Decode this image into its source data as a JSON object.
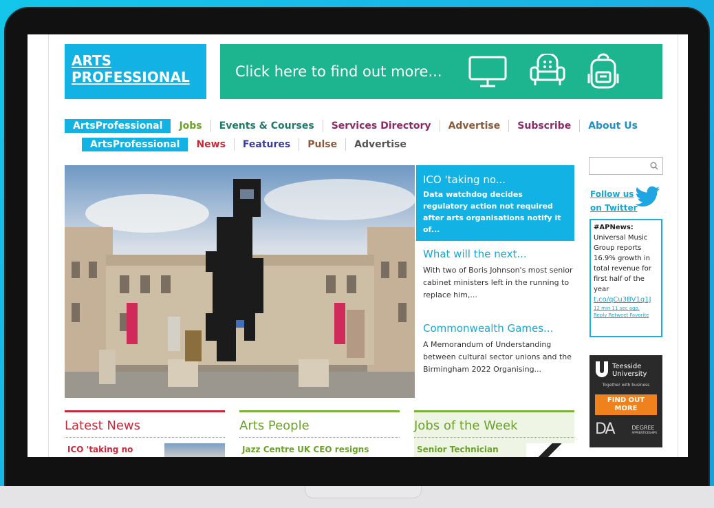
{
  "site": {
    "logo_line1": "ARTS",
    "logo_line2": "PROFESSIONAL",
    "banner_text": "Click here to find out more...",
    "banner_icons": [
      "monitor-icon",
      "armchair-icon",
      "backpack-icon"
    ]
  },
  "nav_primary": {
    "brand": "ArtsProfessional",
    "items": [
      {
        "label": "Jobs",
        "color": "#6aa22c"
      },
      {
        "label": "Events & Courses",
        "color": "#1f7a6a"
      },
      {
        "label": "Services Directory",
        "color": "#8d2a66"
      },
      {
        "label": "Advertise",
        "color": "#8a5a3c"
      },
      {
        "label": "Subscribe",
        "color": "#8d2a66"
      },
      {
        "label": "About Us",
        "color": "#1e8fc8"
      }
    ]
  },
  "nav_secondary": {
    "brand": "ArtsProfessional",
    "items": [
      {
        "label": "News",
        "color": "#c72a3a"
      },
      {
        "label": "Features",
        "color": "#3b3f9a"
      },
      {
        "label": "Pulse",
        "color": "#8a5a3c"
      },
      {
        "label": "Advertise",
        "color": "#555555"
      }
    ]
  },
  "features": [
    {
      "title": "ICO 'taking no...",
      "body": "Data watchdog decides regulatory action not required after arts organisations notify it of..."
    },
    {
      "title": "What will the next...",
      "body": "With two of Boris Johnson's most senior cabinet ministers left in the running to replace him,..."
    },
    {
      "title": "Commonwealth Games...",
      "body": "A Memorandum of Understanding between cultural sector unions and the Birmingham 2022 Organising..."
    }
  ],
  "sidebar": {
    "follow_line1": "Follow us",
    "follow_line2": "on Twitter",
    "tweet": {
      "tag": "#APNews:",
      "body": "Universal Music Group reports 16.9% growth in total revenue for first half of the year",
      "link": "t.co/qCu3BV1q1J",
      "time": "12 min 11 sec ago.",
      "actions": "Reply Retweet Favorite"
    },
    "ad": {
      "uni_line1": "Teesside",
      "uni_line2": "University",
      "tagline": "Together with business",
      "cta_line1": "FIND OUT",
      "cta_line2": "MORE",
      "da_mark": "DA",
      "da_line1": "DEGREE",
      "da_line2": "APPRENTICESHIPS"
    }
  },
  "columns": [
    {
      "title": "Latest News",
      "color": "#c72a3a",
      "first_item": "ICO 'taking no"
    },
    {
      "title": "Arts People",
      "color": "#6aa22c",
      "first_item": "Jazz Centre UK CEO resigns"
    },
    {
      "title": "Jobs of the Week",
      "color": "#6aa22c",
      "first_item": "Senior Technician"
    }
  ]
}
